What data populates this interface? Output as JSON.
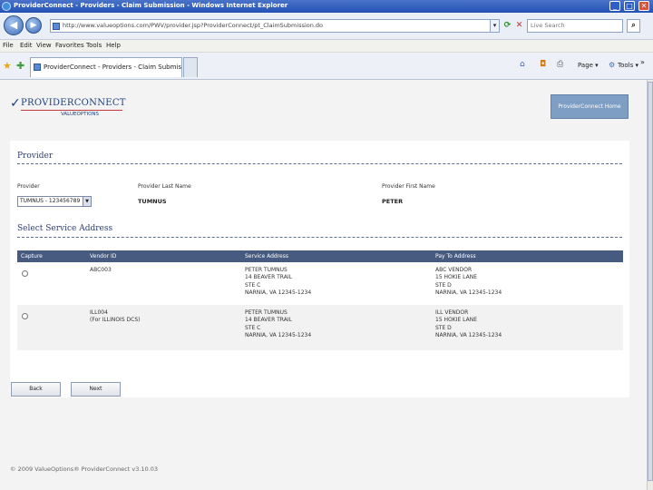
{
  "window": {
    "title": "ProviderConnect - Providers - Claim Submission - Windows Internet Explorer",
    "minimize": "_",
    "maximize": "□",
    "close": "✕"
  },
  "address_bar": {
    "url": "http://www.valueoptions.com/PWV/provider.jsp?ProviderConnect/pt_ClaimSubmission.do",
    "search_placeholder": "Live Search"
  },
  "menu": [
    "File",
    "Edit",
    "View",
    "Favorites",
    "Tools",
    "Help"
  ],
  "tab": {
    "label": "ProviderConnect - Providers - Claim Submission"
  },
  "command_bar": {
    "page_label": "Page ▾",
    "tools_label": "Tools ▾",
    "chevron": "»"
  },
  "brand": {
    "name": "PROVIDERCONNECT",
    "sub": "VALUEOPTIONS",
    "home_button": "ProviderConnect Home"
  },
  "provider": {
    "title": "Provider",
    "provider_label": "Provider",
    "provider_selected": "TUMNUS - 123456789",
    "last_name_label": "Provider Last Name",
    "last_name_value": "TUMNUS",
    "first_name_label": "Provider First Name",
    "first_name_value": "PETER"
  },
  "service_address": {
    "title": "Select Service Address",
    "columns": [
      "Capture",
      "Vendor ID",
      "Service Address",
      "Pay To Address"
    ],
    "rows": [
      {
        "vendor": [
          "ABC003",
          ""
        ],
        "service": [
          "PETER TUMNUS",
          "14 BEAVER TRAIL",
          "STE C",
          "NARNIA, VA 12345-1234"
        ],
        "payto": [
          "ABC VENDOR",
          "15 HOKIE LANE",
          "STE D",
          "NARNIA, VA 12345-1234"
        ]
      },
      {
        "vendor": [
          "ILL004",
          "(For ILLINOIS DCS)"
        ],
        "service": [
          "PETER TUMNUS",
          "14 BEAVER TRAIL",
          "STE C",
          "NARNIA, VA 12345-1234"
        ],
        "payto": [
          "ILL VENDOR",
          "15 HOKIE LANE",
          "STE D",
          "NARNIA, VA 12345-1234"
        ]
      }
    ]
  },
  "buttons": {
    "back": "Back",
    "next": "Next"
  },
  "footer": "© 2009 ValueOptions® ProviderConnect v3.10.03"
}
